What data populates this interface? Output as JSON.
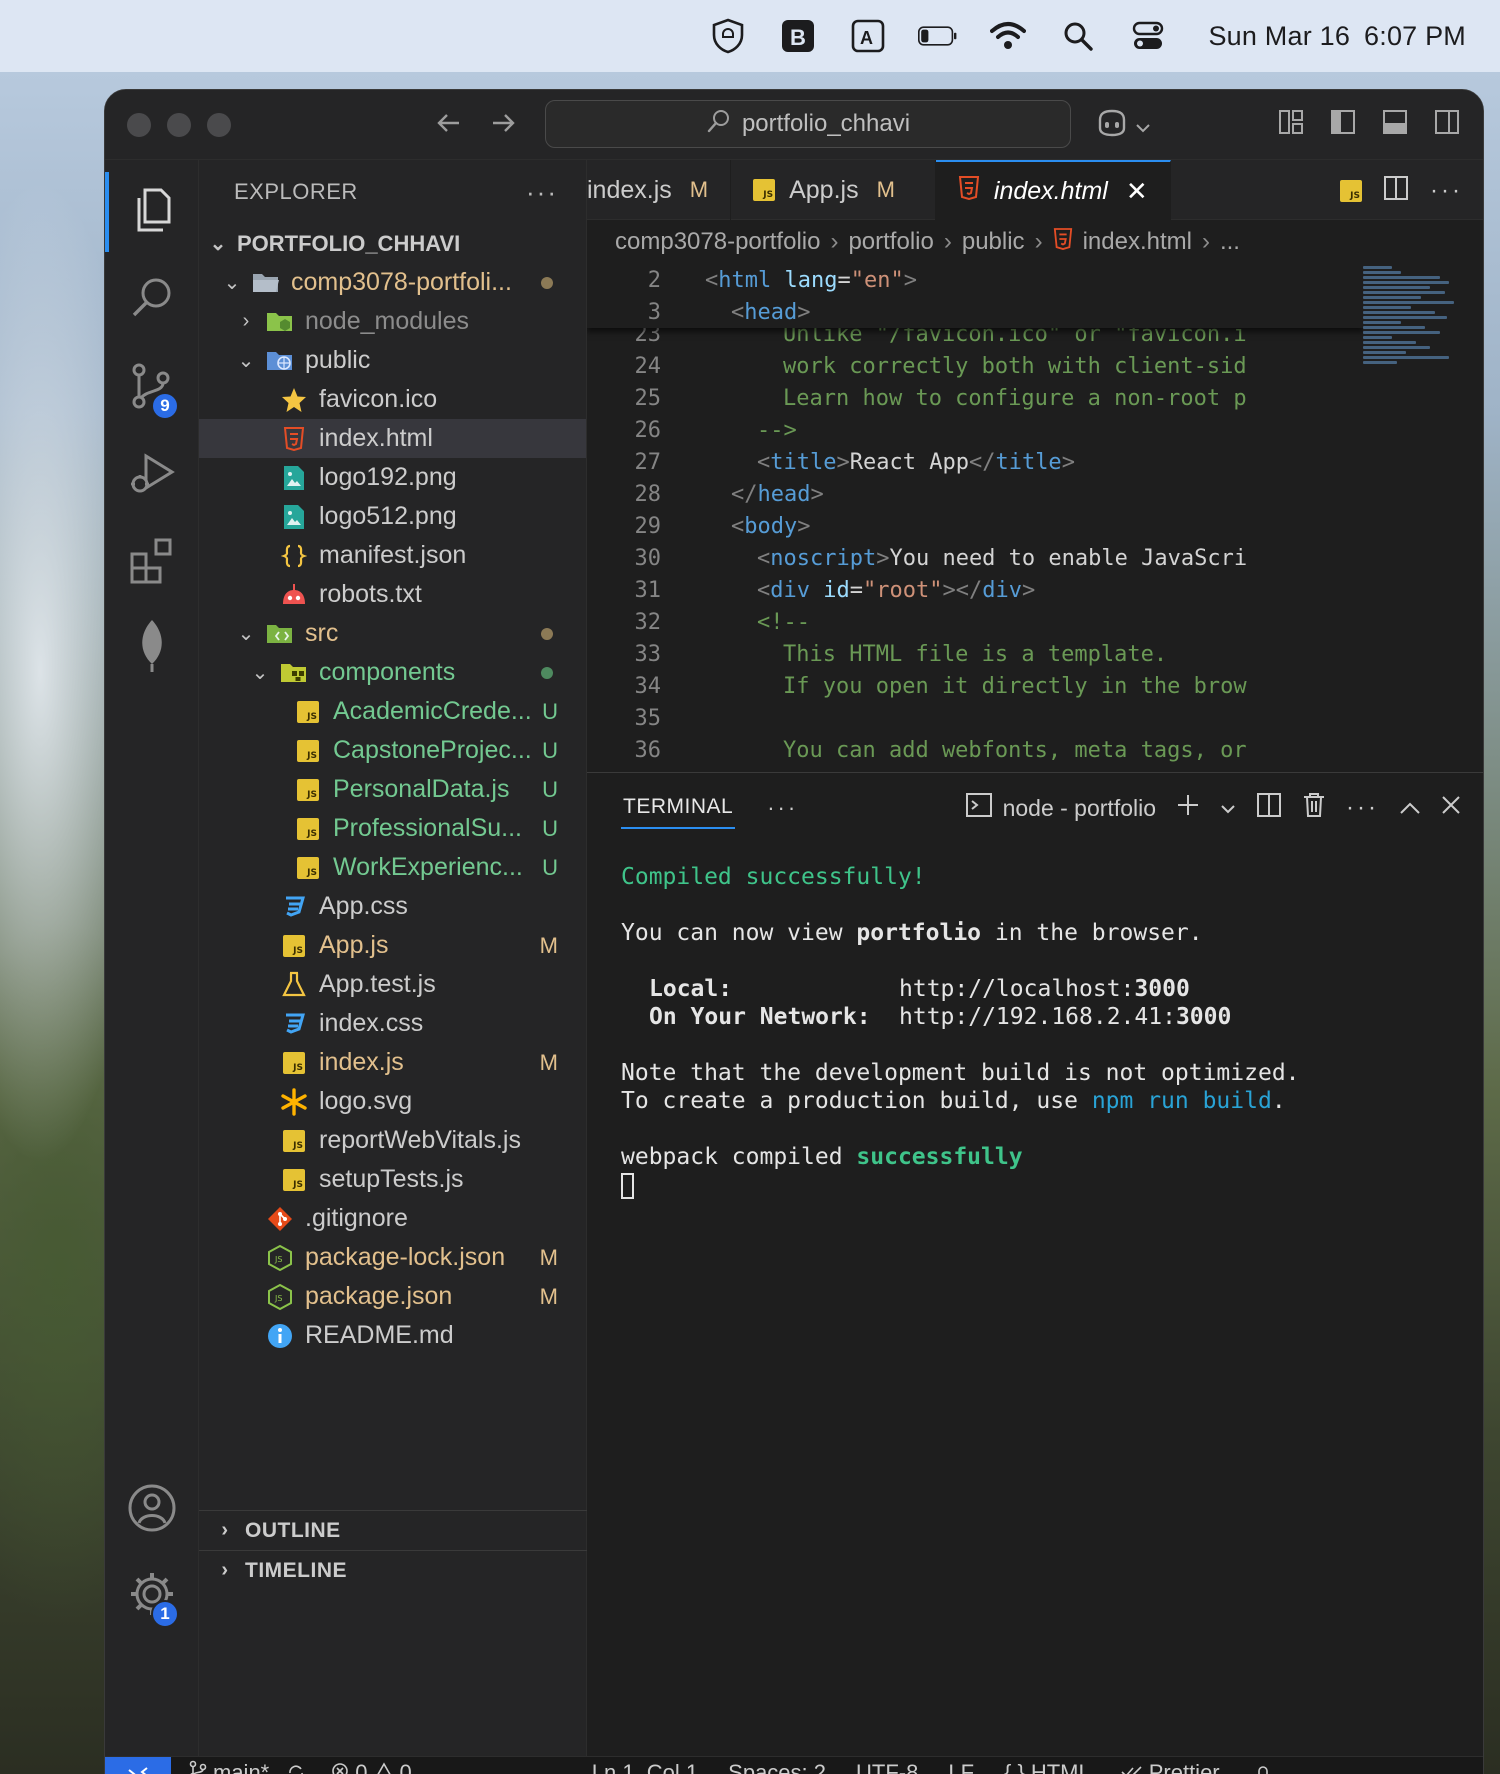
{
  "menubar": {
    "date": "Sun Mar 16",
    "time": "6:07 PM"
  },
  "titlebar": {
    "search_text": "portfolio_chhavi"
  },
  "activity": {
    "source_control_badge": "9",
    "settings_badge": "1"
  },
  "sidebar": {
    "header": "EXPLORER",
    "header_menu": "···",
    "root": "PORTFOLIO_CHHAVI",
    "outline": "OUTLINE",
    "timeline": "TIMELINE",
    "items": [
      {
        "label": "comp3078-portfoli...",
        "status": ""
      },
      {
        "label": "node_modules",
        "status": ""
      },
      {
        "label": "public",
        "status": ""
      },
      {
        "label": "favicon.ico",
        "status": ""
      },
      {
        "label": "index.html",
        "status": ""
      },
      {
        "label": "logo192.png",
        "status": ""
      },
      {
        "label": "logo512.png",
        "status": ""
      },
      {
        "label": "manifest.json",
        "status": ""
      },
      {
        "label": "robots.txt",
        "status": ""
      },
      {
        "label": "src",
        "status": ""
      },
      {
        "label": "components",
        "status": ""
      },
      {
        "label": "AcademicCrede...",
        "status": "U"
      },
      {
        "label": "CapstoneProjec...",
        "status": "U"
      },
      {
        "label": "PersonalData.js",
        "status": "U"
      },
      {
        "label": "ProfessionalSu...",
        "status": "U"
      },
      {
        "label": "WorkExperienc...",
        "status": "U"
      },
      {
        "label": "App.css",
        "status": ""
      },
      {
        "label": "App.js",
        "status": "M"
      },
      {
        "label": "App.test.js",
        "status": ""
      },
      {
        "label": "index.css",
        "status": ""
      },
      {
        "label": "index.js",
        "status": "M"
      },
      {
        "label": "logo.svg",
        "status": ""
      },
      {
        "label": "reportWebVitals.js",
        "status": ""
      },
      {
        "label": "setupTests.js",
        "status": ""
      },
      {
        "label": ".gitignore",
        "status": ""
      },
      {
        "label": "package-lock.json",
        "status": "M"
      },
      {
        "label": "package.json",
        "status": "M"
      },
      {
        "label": "README.md",
        "status": ""
      }
    ]
  },
  "editor": {
    "tabs": [
      {
        "label": "index.js",
        "mod": "M"
      },
      {
        "label": "App.js",
        "mod": "M"
      },
      {
        "label": "index.html",
        "close": "✕"
      }
    ],
    "breadcrumb": [
      "comp3078-portfolio",
      "portfolio",
      "public",
      "index.html",
      "..."
    ],
    "lines": [
      {
        "n": "2",
        "text": "<html lang=\"en\">"
      },
      {
        "n": "3",
        "text": "<head>"
      },
      {
        "n": "23",
        "text": "Unlike \"/favicon.ico\" or \"favicon.i"
      },
      {
        "n": "24",
        "text": "work correctly both with client-sid"
      },
      {
        "n": "25",
        "text": "Learn how to configure a non-root p"
      },
      {
        "n": "26",
        "text": "-->"
      },
      {
        "n": "27",
        "text": "<title>React App</title>"
      },
      {
        "n": "28",
        "text": "</head>"
      },
      {
        "n": "29",
        "text": "<body>"
      },
      {
        "n": "30",
        "text": "<noscript>You need to enable JavaScri"
      },
      {
        "n": "31",
        "text": "<div id=\"root\"></div>"
      },
      {
        "n": "32",
        "text": "<!--"
      },
      {
        "n": "33",
        "text": "This HTML file is a template."
      },
      {
        "n": "34",
        "text": "If you open it directly in the brow"
      },
      {
        "n": "35",
        "text": ""
      },
      {
        "n": "36",
        "text": "You can add webfonts, meta tags, or"
      }
    ]
  },
  "panel": {
    "tab": "TERMINAL",
    "menu": "···",
    "terminal_name": "node - portfolio",
    "output": {
      "compiled": "Compiled successfully!",
      "view_prefix": "You can now view ",
      "view_app": "portfolio",
      "view_suffix": " in the browser.",
      "local_label": "Local:",
      "local_url": "http://localhost:",
      "local_port": "3000",
      "network_label": "On Your Network:",
      "network_url": "http://192.168.2.41:",
      "network_port": "3000",
      "note1": "Note that the development build is not optimized.",
      "note2_prefix": "To create a production build, use ",
      "note2_cmd": "npm run build",
      "note2_suffix": ".",
      "webpack_prefix": "webpack compiled ",
      "webpack_status": "successfully"
    }
  },
  "statusbar": {
    "branch": "main*",
    "errors": "0",
    "warnings": "0",
    "position": "Ln 1, Col 1",
    "spaces": "Spaces: 2",
    "encoding": "UTF-8",
    "eol": "LF",
    "language": "HTML",
    "formatter": "Prettier"
  },
  "colors": {
    "accent": "#2b8ef0",
    "modified": "#e2c08d",
    "untracked": "#73c991",
    "terminal_success": "#3fc48a"
  }
}
